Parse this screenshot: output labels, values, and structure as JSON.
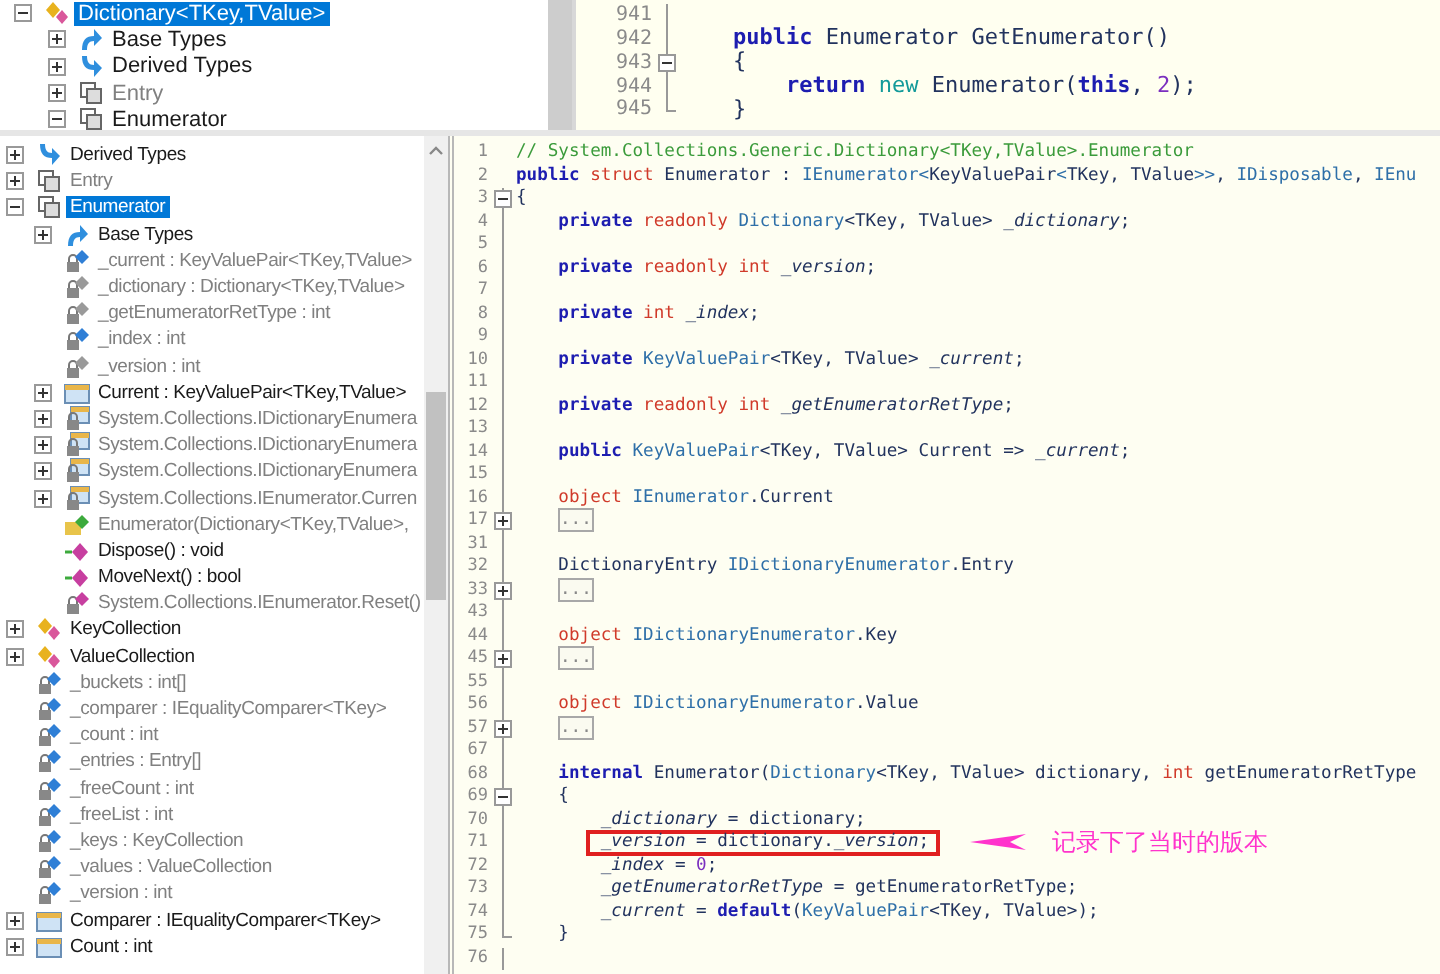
{
  "top_tree": {
    "items": [
      {
        "label": "Dictionary<TKey,TValue>",
        "kind": "class",
        "expanded": true,
        "greyed": false,
        "selected": true,
        "children": [
          {
            "label": "Base Types",
            "kind": "base-types",
            "expanded": false,
            "greyed": false,
            "selected": false
          },
          {
            "label": "Derived Types",
            "kind": "derived-types",
            "expanded": false,
            "greyed": false,
            "selected": false
          },
          {
            "label": "Entry",
            "kind": "struct",
            "expanded": false,
            "greyed": true,
            "selected": false
          },
          {
            "label": "Enumerator",
            "kind": "struct",
            "expanded": true,
            "greyed": false,
            "selected": false
          }
        ]
      }
    ]
  },
  "top_code": {
    "lines": [
      {
        "number": "941",
        "kind": "plain"
      },
      {
        "number": "942",
        "kind": "plain",
        "segments": [
          {
            "kind": "k",
            "text": "    public"
          },
          {
            "kind": "n",
            "text": " Enumerator GetEnumerator()"
          }
        ]
      },
      {
        "number": "943",
        "kind": "open",
        "segments": [
          {
            "kind": "p",
            "text": "    {"
          }
        ]
      },
      {
        "number": "944",
        "kind": "plain",
        "segments": [
          {
            "kind": "k",
            "text": "        return"
          },
          {
            "kind": "nw",
            "text": " new"
          },
          {
            "kind": "p",
            "text": " Enumerator("
          },
          {
            "kind": "k",
            "text": "this"
          },
          {
            "kind": "p",
            "text": ", "
          },
          {
            "kind": "num",
            "text": "2"
          },
          {
            "kind": "p",
            "text": ");"
          }
        ]
      },
      {
        "number": "945",
        "kind": "end",
        "segments": [
          {
            "kind": "p",
            "text": "    }"
          }
        ]
      }
    ]
  },
  "tree": {
    "items": [
      {
        "label": "Derived Types",
        "kind": "derived-types",
        "expanded": false,
        "greyed": false,
        "selected": false
      },
      {
        "label": "Entry",
        "kind": "struct",
        "expanded": false,
        "greyed": true,
        "selected": false
      },
      {
        "label": "Enumerator",
        "kind": "struct",
        "expanded": true,
        "greyed": false,
        "selected": true,
        "children": [
          {
            "label": "Base Types",
            "kind": "base-types",
            "expanded": false,
            "greyed": false,
            "selected": false
          },
          {
            "label": "_current : KeyValuePair<TKey,TValue>",
            "kind": "field",
            "greyed": true,
            "selected": false
          },
          {
            "label": "_dictionary : Dictionary<TKey,TValue>",
            "kind": "readonly-field",
            "greyed": true,
            "selected": false
          },
          {
            "label": "_getEnumeratorRetType : int",
            "kind": "readonly-field",
            "greyed": true,
            "selected": false
          },
          {
            "label": "_index : int",
            "kind": "field",
            "greyed": true,
            "selected": false
          },
          {
            "label": "_version : int",
            "kind": "readonly-field",
            "greyed": true,
            "selected": false
          },
          {
            "label": "Current : KeyValuePair<TKey,TValue>",
            "kind": "property",
            "expanded": false,
            "greyed": false,
            "selected": false
          },
          {
            "label": "System.Collections.IDictionaryEnumera",
            "kind": "private-property",
            "expanded": false,
            "greyed": true,
            "selected": false
          },
          {
            "label": "System.Collections.IDictionaryEnumera",
            "kind": "private-property",
            "expanded": false,
            "greyed": true,
            "selected": false
          },
          {
            "label": "System.Collections.IDictionaryEnumera",
            "kind": "private-property",
            "expanded": false,
            "greyed": true,
            "selected": false
          },
          {
            "label": "System.Collections.IEnumerator.Curren",
            "kind": "private-property",
            "expanded": false,
            "greyed": true,
            "selected": false
          },
          {
            "label": "Enumerator(Dictionary<TKey,TValue>,",
            "kind": "constructor",
            "greyed": true,
            "selected": false
          },
          {
            "label": "Dispose() : void",
            "kind": "method",
            "greyed": false,
            "selected": false
          },
          {
            "label": "MoveNext() : bool",
            "kind": "method",
            "greyed": false,
            "selected": false
          },
          {
            "label": "System.Collections.IEnumerator.Reset()",
            "kind": "private-method",
            "greyed": true,
            "selected": false
          }
        ]
      },
      {
        "label": "KeyCollection",
        "kind": "class",
        "expanded": false,
        "greyed": false,
        "selected": false
      },
      {
        "label": "ValueCollection",
        "kind": "class",
        "expanded": false,
        "greyed": false,
        "selected": false
      },
      {
        "label": "_buckets : int[]",
        "kind": "field",
        "greyed": true,
        "selected": false
      },
      {
        "label": "_comparer : IEqualityComparer<TKey>",
        "kind": "field",
        "greyed": true,
        "selected": false
      },
      {
        "label": "_count : int",
        "kind": "field",
        "greyed": true,
        "selected": false
      },
      {
        "label": "_entries : Entry[]",
        "kind": "field",
        "greyed": true,
        "selected": false
      },
      {
        "label": "_freeCount : int",
        "kind": "field",
        "greyed": true,
        "selected": false
      },
      {
        "label": "_freeList : int",
        "kind": "field",
        "greyed": true,
        "selected": false
      },
      {
        "label": "_keys : KeyCollection",
        "kind": "field",
        "greyed": true,
        "selected": false
      },
      {
        "label": "_values : ValueCollection",
        "kind": "field",
        "greyed": true,
        "selected": false
      },
      {
        "label": "_version : int",
        "kind": "field",
        "greyed": true,
        "selected": false
      },
      {
        "label": "Comparer : IEqualityComparer<TKey>",
        "kind": "property",
        "expanded": false,
        "greyed": false,
        "selected": false
      },
      {
        "label": "Count : int",
        "kind": "property",
        "expanded": false,
        "greyed": false,
        "selected": false
      }
    ]
  },
  "code": {
    "lines": [
      {
        "number": "1",
        "kind": "top",
        "boxed": false,
        "segments": [
          {
            "kind": "c",
            "text": "// System.Collections.Generic.Dictionary<TKey,TValue>.Enumerator"
          }
        ]
      },
      {
        "number": "2",
        "kind": "top",
        "boxed": false,
        "segments": [
          {
            "kind": "k",
            "text": "public"
          },
          {
            "kind": "m",
            "text": " struct"
          },
          {
            "kind": "n",
            "text": " Enumerator"
          },
          {
            "kind": "p",
            "text": " : "
          },
          {
            "kind": "t",
            "text": "IEnumerator<"
          },
          {
            "kind": "n",
            "text": "KeyValuePair"
          },
          {
            "kind": "t",
            "text": "<"
          },
          {
            "kind": "n",
            "text": "TKey, TValue"
          },
          {
            "kind": "t",
            "text": ">>"
          },
          {
            "kind": "p",
            "text": ", "
          },
          {
            "kind": "t",
            "text": "IDisposable"
          },
          {
            "kind": "p",
            "text": ", "
          },
          {
            "kind": "t",
            "text": "IEnu"
          }
        ]
      },
      {
        "number": "3",
        "kind": "open",
        "boxed": false,
        "segments": [
          {
            "kind": "p",
            "text": "{"
          }
        ]
      },
      {
        "number": "4",
        "kind": "plain",
        "boxed": false,
        "segments": [
          {
            "kind": "k",
            "text": "    private"
          },
          {
            "kind": "m",
            "text": " readonly"
          },
          {
            "kind": "t",
            "text": " Dictionary"
          },
          {
            "kind": "p",
            "text": "<TKey, TValue> "
          },
          {
            "kind": "f",
            "text": "_dictionary"
          },
          {
            "kind": "p",
            "text": ";"
          }
        ]
      },
      {
        "number": "5",
        "kind": "plain",
        "boxed": false
      },
      {
        "number": "6",
        "kind": "plain",
        "boxed": false,
        "segments": [
          {
            "kind": "k",
            "text": "    private"
          },
          {
            "kind": "m",
            "text": " readonly int"
          },
          {
            "kind": "f",
            "text": " _version"
          },
          {
            "kind": "p",
            "text": ";"
          }
        ]
      },
      {
        "number": "7",
        "kind": "plain",
        "boxed": false
      },
      {
        "number": "8",
        "kind": "plain",
        "boxed": false,
        "segments": [
          {
            "kind": "k",
            "text": "    private"
          },
          {
            "kind": "m",
            "text": " int"
          },
          {
            "kind": "f",
            "text": " _index"
          },
          {
            "kind": "p",
            "text": ";"
          }
        ]
      },
      {
        "number": "9",
        "kind": "plain",
        "boxed": false
      },
      {
        "number": "10",
        "kind": "plain",
        "boxed": false,
        "segments": [
          {
            "kind": "k",
            "text": "    private"
          },
          {
            "kind": "t",
            "text": " KeyValuePair"
          },
          {
            "kind": "p",
            "text": "<TKey, TValue> "
          },
          {
            "kind": "f",
            "text": "_current"
          },
          {
            "kind": "p",
            "text": ";"
          }
        ]
      },
      {
        "number": "11",
        "kind": "plain",
        "boxed": false
      },
      {
        "number": "12",
        "kind": "plain",
        "boxed": false,
        "segments": [
          {
            "kind": "k",
            "text": "    private"
          },
          {
            "kind": "m",
            "text": " readonly int"
          },
          {
            "kind": "f",
            "text": " _getEnumeratorRetType"
          },
          {
            "kind": "p",
            "text": ";"
          }
        ]
      },
      {
        "number": "13",
        "kind": "plain",
        "boxed": false
      },
      {
        "number": "14",
        "kind": "plain",
        "boxed": false,
        "segments": [
          {
            "kind": "k",
            "text": "    public"
          },
          {
            "kind": "t",
            "text": " KeyValuePair"
          },
          {
            "kind": "p",
            "text": "<TKey, TValue> Current => "
          },
          {
            "kind": "f",
            "text": "_current"
          },
          {
            "kind": "p",
            "text": ";"
          }
        ]
      },
      {
        "number": "15",
        "kind": "plain",
        "boxed": false
      },
      {
        "number": "16",
        "kind": "plain",
        "boxed": false,
        "segments": [
          {
            "kind": "m",
            "text": "    object"
          },
          {
            "kind": "t",
            "text": " IEnumerator"
          },
          {
            "kind": "p",
            "text": ".Current"
          }
        ]
      },
      {
        "number": "17",
        "kind": "closed",
        "boxed": false,
        "segments": [
          {
            "kind": "x",
            "text": "..."
          }
        ]
      },
      {
        "number": "31",
        "kind": "plain",
        "boxed": false
      },
      {
        "number": "32",
        "kind": "plain",
        "boxed": false,
        "segments": [
          {
            "kind": "n",
            "text": "    DictionaryEntry"
          },
          {
            "kind": "t",
            "text": " IDictionaryEnumerator"
          },
          {
            "kind": "p",
            "text": ".Entry"
          }
        ]
      },
      {
        "number": "33",
        "kind": "closed",
        "boxed": false,
        "segments": [
          {
            "kind": "x",
            "text": "..."
          }
        ]
      },
      {
        "number": "43",
        "kind": "plain",
        "boxed": false
      },
      {
        "number": "44",
        "kind": "plain",
        "boxed": false,
        "segments": [
          {
            "kind": "m",
            "text": "    object"
          },
          {
            "kind": "t",
            "text": " IDictionaryEnumerator"
          },
          {
            "kind": "p",
            "text": ".Key"
          }
        ]
      },
      {
        "number": "45",
        "kind": "closed",
        "boxed": false,
        "segments": [
          {
            "kind": "x",
            "text": "..."
          }
        ]
      },
      {
        "number": "55",
        "kind": "plain",
        "boxed": false
      },
      {
        "number": "56",
        "kind": "plain",
        "boxed": false,
        "segments": [
          {
            "kind": "m",
            "text": "    object"
          },
          {
            "kind": "t",
            "text": " IDictionaryEnumerator"
          },
          {
            "kind": "p",
            "text": ".Value"
          }
        ]
      },
      {
        "number": "57",
        "kind": "closed",
        "boxed": false,
        "segments": [
          {
            "kind": "x",
            "text": "..."
          }
        ]
      },
      {
        "number": "67",
        "kind": "plain",
        "boxed": false
      },
      {
        "number": "68",
        "kind": "plain",
        "boxed": false,
        "segments": [
          {
            "kind": "k",
            "text": "    internal"
          },
          {
            "kind": "p",
            "text": " Enumerator("
          },
          {
            "kind": "t",
            "text": "Dictionary"
          },
          {
            "kind": "p",
            "text": "<TKey, TValue> dictionary, "
          },
          {
            "kind": "m",
            "text": "int"
          },
          {
            "kind": "p",
            "text": " getEnumeratorRetType"
          }
        ]
      },
      {
        "number": "69",
        "kind": "open",
        "boxed": false,
        "segments": [
          {
            "kind": "p",
            "text": "    {"
          }
        ]
      },
      {
        "number": "70",
        "kind": "plain",
        "boxed": false,
        "segments": [
          {
            "kind": "f",
            "text": "        _dictionary"
          },
          {
            "kind": "p",
            "text": " = dictionary;"
          }
        ]
      },
      {
        "number": "71",
        "kind": "plain",
        "boxed": true,
        "segments": [
          {
            "kind": "f",
            "text": "        _version"
          },
          {
            "kind": "p",
            "text": " = dictionary."
          },
          {
            "kind": "f",
            "text": "_version"
          },
          {
            "kind": "p",
            "text": ";"
          }
        ]
      },
      {
        "number": "72",
        "kind": "plain",
        "boxed": false,
        "segments": [
          {
            "kind": "f",
            "text": "        _index"
          },
          {
            "kind": "p",
            "text": " = "
          },
          {
            "kind": "num",
            "text": "0"
          },
          {
            "kind": "p",
            "text": ";"
          }
        ]
      },
      {
        "number": "73",
        "kind": "plain",
        "boxed": false,
        "segments": [
          {
            "kind": "f",
            "text": "        _getEnumeratorRetType"
          },
          {
            "kind": "p",
            "text": " = getEnumeratorRetType;"
          }
        ]
      },
      {
        "number": "74",
        "kind": "plain",
        "boxed": false,
        "segments": [
          {
            "kind": "f",
            "text": "        _current"
          },
          {
            "kind": "p",
            "text": " = "
          },
          {
            "kind": "k",
            "text": "default"
          },
          {
            "kind": "p",
            "text": "("
          },
          {
            "kind": "t",
            "text": "KeyValuePair"
          },
          {
            "kind": "p",
            "text": "<TKey, TValue>);"
          }
        ]
      },
      {
        "number": "75",
        "kind": "end",
        "boxed": false,
        "segments": [
          {
            "kind": "p",
            "text": "    }"
          }
        ]
      },
      {
        "number": "76",
        "kind": "plain",
        "boxed": false
      }
    ]
  },
  "annotation": {
    "text": "记录下了当时的版本"
  }
}
